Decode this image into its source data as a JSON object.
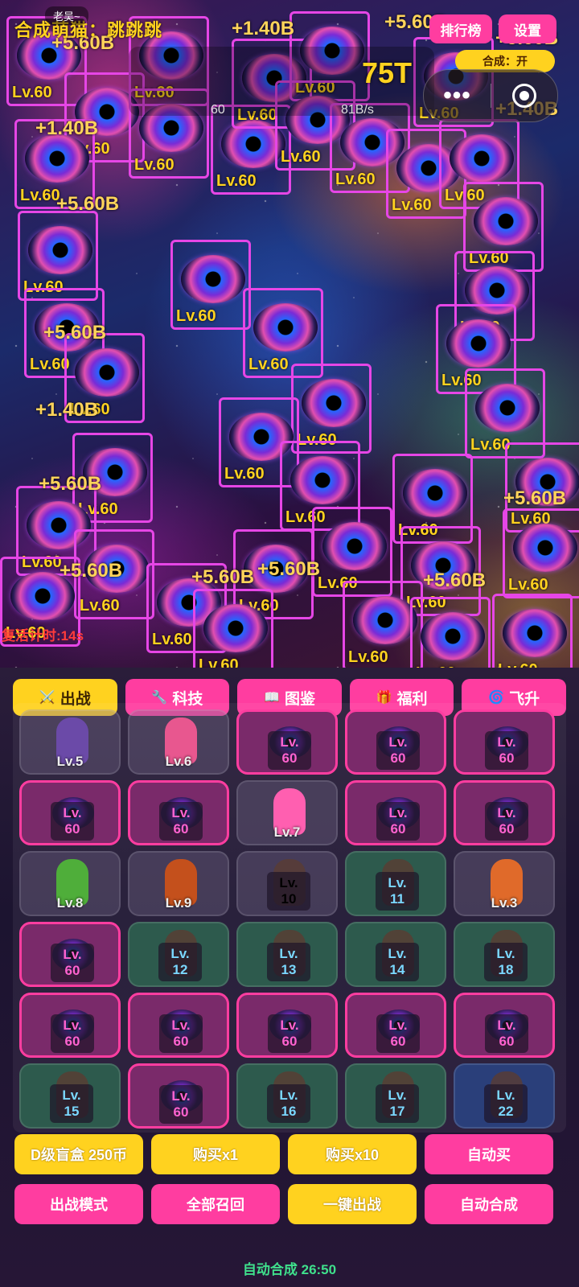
{
  "header": {
    "title": "合成萌猫：跳跳跳",
    "player_name": "老吴~",
    "score_value": "75T",
    "score_sub_left": "60",
    "score_sub_right": "81B/s",
    "rank_label": "排行榜",
    "settings_label": "设置",
    "auto_merge_toggle": "合成：开",
    "capsule_dots": "•••"
  },
  "battlefield": {
    "revive_text": "复活计时:14s",
    "units": [
      {
        "lv": "Lv.60"
      },
      {
        "lv": "Lv.60"
      },
      {
        "lv": "Lv.60"
      },
      {
        "lv": "Lv.60"
      },
      {
        "lv": "Lv.60"
      },
      {
        "lv": "Lv.60"
      },
      {
        "lv": "Lv.60"
      },
      {
        "lv": "Lv.60"
      },
      {
        "lv": "Lv.60"
      },
      {
        "lv": "Lv.60"
      },
      {
        "lv": "Lv.60"
      },
      {
        "lv": "Lv.60"
      },
      {
        "lv": "Lv.60"
      },
      {
        "lv": "Lv.60"
      },
      {
        "lv": "Lv.60"
      },
      {
        "lv": "Lv.60"
      },
      {
        "lv": "Lv.60"
      },
      {
        "lv": "Lv.60"
      },
      {
        "lv": "Lv.60"
      },
      {
        "lv": "Lv.60"
      },
      {
        "lv": "Lv.60"
      },
      {
        "lv": "Lv.60"
      },
      {
        "lv": "Lv.60"
      },
      {
        "lv": "Lv.60"
      },
      {
        "lv": "Lv.60"
      },
      {
        "lv": "Lv.60"
      },
      {
        "lv": "Lv.60"
      },
      {
        "lv": "Lv.60"
      },
      {
        "lv": "Lv.60"
      },
      {
        "lv": "Lv.60"
      }
    ],
    "damage_numbers": [
      "+5.60B",
      "+1.40B",
      "+5.60B",
      "+1.40B",
      "+5.60B",
      "+5.60B",
      "+1.40B",
      "+5.60B",
      "+5.60B",
      "+5.60B",
      "+5.60B",
      "+5.60B",
      "+5.60B",
      "+5.60B",
      "+1.40B"
    ]
  },
  "tabs": [
    {
      "icon": "⚔️",
      "label": "出战",
      "active": true
    },
    {
      "icon": "🔧",
      "label": "科技",
      "active": false
    },
    {
      "icon": "📖",
      "label": "图鉴",
      "active": false
    },
    {
      "icon": "🎁",
      "label": "福利",
      "active": false
    },
    {
      "icon": "🌀",
      "label": "飞升",
      "active": false
    }
  ],
  "grid": [
    {
      "type": "cat",
      "lv": "Lv.5",
      "color": "#6b4aa8"
    },
    {
      "type": "cat",
      "lv": "Lv.6",
      "color": "#e8578f"
    },
    {
      "type": "eye60",
      "lv1": "Lv.",
      "lv2": "60"
    },
    {
      "type": "eye60",
      "lv1": "Lv.",
      "lv2": "60"
    },
    {
      "type": "eye60",
      "lv1": "Lv.",
      "lv2": "60"
    },
    {
      "type": "eye60",
      "lv1": "Lv.",
      "lv2": "60"
    },
    {
      "type": "eye60",
      "lv1": "Lv.",
      "lv2": "60"
    },
    {
      "type": "cat",
      "lv": "Lv.7",
      "color": "#ff5fb0"
    },
    {
      "type": "eye60",
      "lv1": "Lv.",
      "lv2": "60"
    },
    {
      "type": "eye60",
      "lv1": "Lv.",
      "lv2": "60"
    },
    {
      "type": "cat",
      "lv": "Lv.8",
      "color": "#4fae3a"
    },
    {
      "type": "cat",
      "lv": "Lv.9",
      "color": "#c4501c"
    },
    {
      "type": "boxcat",
      "lv1": "Lv.",
      "lv2": "10",
      "style": "plain"
    },
    {
      "type": "boxcat",
      "lv1": "Lv.",
      "lv2": "11",
      "style": "green"
    },
    {
      "type": "cat",
      "lv": "Lv.3",
      "color": "#e06a2a"
    },
    {
      "type": "eye60",
      "lv1": "Lv.",
      "lv2": "60"
    },
    {
      "type": "boxcat",
      "lv1": "Lv.",
      "lv2": "12",
      "style": "green"
    },
    {
      "type": "boxcat",
      "lv1": "Lv.",
      "lv2": "13",
      "style": "green"
    },
    {
      "type": "boxcat",
      "lv1": "Lv.",
      "lv2": "14",
      "style": "green"
    },
    {
      "type": "boxcat",
      "lv1": "Lv.",
      "lv2": "18",
      "style": "green"
    },
    {
      "type": "eye60",
      "lv1": "Lv.",
      "lv2": "60"
    },
    {
      "type": "eye60",
      "lv1": "Lv.",
      "lv2": "60"
    },
    {
      "type": "eye60",
      "lv1": "Lv.",
      "lv2": "60"
    },
    {
      "type": "eye60",
      "lv1": "Lv.",
      "lv2": "60"
    },
    {
      "type": "eye60",
      "lv1": "Lv.",
      "lv2": "60"
    },
    {
      "type": "boxcat",
      "lv1": "Lv.",
      "lv2": "15",
      "style": "green"
    },
    {
      "type": "eye60",
      "lv1": "Lv.",
      "lv2": "60"
    },
    {
      "type": "boxcat",
      "lv1": "Lv.",
      "lv2": "16",
      "style": "green"
    },
    {
      "type": "boxcat",
      "lv1": "Lv.",
      "lv2": "17",
      "style": "green"
    },
    {
      "type": "boxcat",
      "lv1": "Lv.",
      "lv2": "22",
      "style": "blue"
    }
  ],
  "actions_row1": [
    {
      "label": "D级盲盒 250币",
      "color": "yellow"
    },
    {
      "label": "购买x1",
      "color": "yellow"
    },
    {
      "label": "购买x10",
      "color": "yellow"
    },
    {
      "label": "自动买",
      "color": "pink"
    }
  ],
  "actions_row2": [
    {
      "label": "出战模式",
      "color": "pink"
    },
    {
      "label": "全部召回",
      "color": "pink"
    },
    {
      "label": "一键出战",
      "color": "yellow"
    },
    {
      "label": "自动合成",
      "color": "pink"
    }
  ],
  "footer_timer": "自动合成 26:50"
}
